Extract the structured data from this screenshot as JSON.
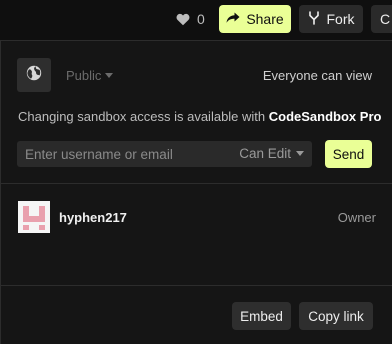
{
  "header": {
    "like_count": "0",
    "share_label": "Share",
    "fork_label": "Fork",
    "partial_button_label": "C",
    "icons": {
      "like": "heart-icon",
      "share": "share-arrow-icon",
      "fork": "fork-icon"
    }
  },
  "share_panel": {
    "visibility": {
      "value": "Public",
      "description": "Everyone can view",
      "icon": "globe-icon"
    },
    "upsell": {
      "text": "Changing sandbox access is available with ",
      "link": "CodeSandbox Pro"
    },
    "invite": {
      "placeholder": "Enter username or email",
      "permission": "Can Edit",
      "send_label": "Send"
    },
    "members": [
      {
        "name": "hyphen217",
        "role": "Owner"
      }
    ],
    "footer": {
      "embed_label": "Embed",
      "copy_link_label": "Copy link"
    }
  },
  "colors": {
    "accent": "#eaff96",
    "background": "#0f0f0f",
    "panel": "#151515",
    "button": "#2e2e2e",
    "avatar_pink": "#e9a0ad"
  }
}
